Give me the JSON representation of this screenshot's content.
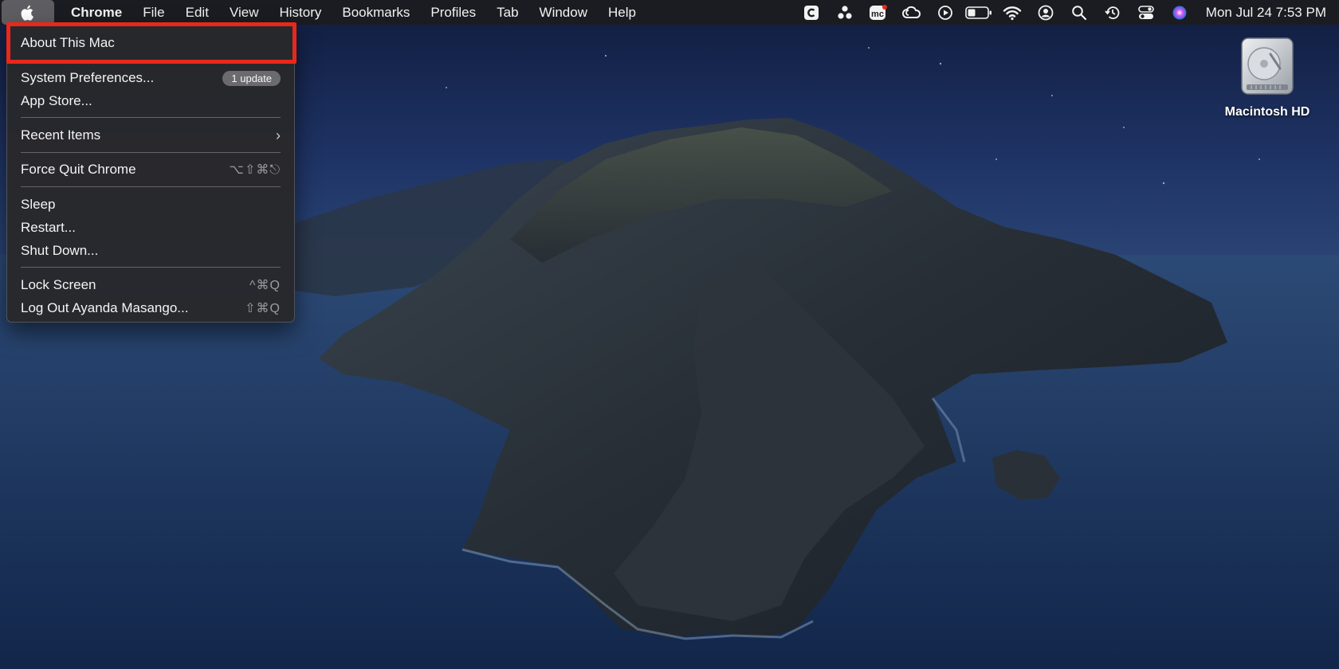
{
  "menubar": {
    "apple_icon": "apple-logo-icon",
    "app_name": "Chrome",
    "menus": [
      "File",
      "Edit",
      "View",
      "History",
      "Bookmarks",
      "Profiles",
      "Tab",
      "Window",
      "Help"
    ],
    "status_icons": [
      "clipboard-c-icon",
      "three-dots-cluster-icon",
      "mc-app-icon",
      "creative-cloud-icon",
      "play-circle-icon",
      "battery-icon",
      "wifi-icon",
      "user-circle-icon",
      "spotlight-search-icon",
      "time-machine-icon",
      "control-center-icon",
      "siri-icon"
    ],
    "clock": "Mon Jul 24  7:53 PM"
  },
  "apple_menu": {
    "items": [
      {
        "label": "About This Mac"
      },
      {
        "label": "System Preferences...",
        "badge": "1 update"
      },
      {
        "label": "App Store..."
      },
      {
        "label": "Recent Items",
        "submenu": "›"
      },
      {
        "label": "Force Quit Chrome",
        "shortcut": "⌥⇧⌘⎋"
      },
      {
        "label": "Sleep"
      },
      {
        "label": "Restart..."
      },
      {
        "label": "Shut Down..."
      },
      {
        "label": "Lock Screen",
        "shortcut": "^⌘Q"
      },
      {
        "label": "Log Out Ayanda Masango...",
        "shortcut": "⇧⌘Q"
      }
    ]
  },
  "desktop": {
    "drive_label": "Macintosh HD",
    "drive_icon": "hard-drive-icon"
  },
  "colors": {
    "highlight_box": "#e8281a",
    "menubar_bg": "#1c1c20",
    "menu_bg": "#28282b"
  }
}
